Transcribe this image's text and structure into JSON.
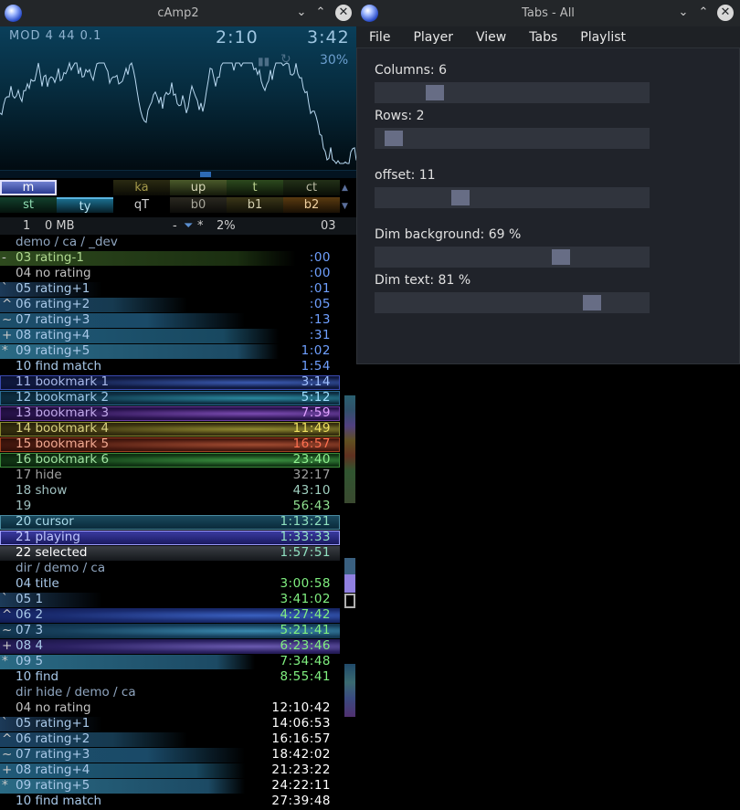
{
  "camp": {
    "title": "cAmp2",
    "mod_info": "MOD  4 44  0.1",
    "time_pos": "2:10",
    "time_len": "3:42",
    "pause_glyph": "▮▮",
    "repeat_glyph": "↻",
    "volume": "30%",
    "seek_fraction": 0.58,
    "buttons_row1": [
      {
        "label": "m",
        "fg": "#ffffff",
        "bg": "#3c4a96"
      },
      {
        "label": "",
        "fg": "#ffffff",
        "bg": "#000000"
      },
      {
        "label": "ka",
        "fg": "#a59a4a",
        "bg": "#2a2a12"
      },
      {
        "label": "up",
        "fg": "#d6d6b6",
        "bg": "#4a5a2a"
      },
      {
        "label": "t",
        "fg": "#b7cf8c",
        "bg": "#2d4a1e"
      },
      {
        "label": "ct",
        "fg": "#b7b7a0",
        "bg": "#223018"
      }
    ],
    "buttons_row2": [
      {
        "label": "st",
        "fg": "#8fdcb2",
        "bg": "#12402c"
      },
      {
        "label": "ty",
        "fg": "#b9e6f5",
        "bg": "#1a6d8d"
      },
      {
        "label": "qT",
        "fg": "#d0d0d0",
        "bg": "#000000"
      },
      {
        "label": "b0",
        "fg": "#a7a59a",
        "bg": "#2a2820"
      },
      {
        "label": "b1",
        "fg": "#d4d0b0",
        "bg": "#3a3618"
      },
      {
        "label": "b2",
        "fg": "#f0d0a0",
        "bg": "#5a3a10"
      }
    ],
    "status": {
      "index": "1",
      "size": "0 MB",
      "dash": "-",
      "filter_icon": "filter-icon",
      "star": "*",
      "percent": "2%",
      "count": "03"
    },
    "playlist": [
      {
        "pre": "",
        "name": "demo / ca / _dev",
        "time": "",
        "fg": "#8fa5bf",
        "tc": "#6fa0ff",
        "hl": "none",
        "bar": 0
      },
      {
        "pre": "-",
        "name": "03 rating-1",
        "time": ":00",
        "fg": "#b0d890",
        "tc": "#6fa0ff",
        "hl": "rating-",
        "bar": 0.87
      },
      {
        "pre": "",
        "name": "04 no rating",
        "time": ":00",
        "fg": "#c0c0c0",
        "tc": "#6fa0ff",
        "hl": "none",
        "bar": 0
      },
      {
        "pre": "`",
        "name": "05 rating+1",
        "time": ":01",
        "fg": "#a8c8e8",
        "tc": "#6fa0ff",
        "hl": "r1",
        "bar": 0.3
      },
      {
        "pre": "^",
        "name": "06 rating+2",
        "time": ":05",
        "fg": "#a8c8e8",
        "tc": "#6fa0ff",
        "hl": "r2",
        "bar": 0.55
      },
      {
        "pre": "~",
        "name": "07 rating+3",
        "time": ":13",
        "fg": "#a8c8e8",
        "tc": "#6fa0ff",
        "hl": "r3",
        "bar": 0.72
      },
      {
        "pre": "+",
        "name": "08 rating+4",
        "time": ":31",
        "fg": "#a8c8e8",
        "tc": "#6fa0ff",
        "hl": "r4",
        "bar": 0.82
      },
      {
        "pre": "*",
        "name": "09 rating+5",
        "time": "1:02",
        "fg": "#a8c8e8",
        "tc": "#6fa0ff",
        "hl": "r5",
        "bar": 0.82
      },
      {
        "pre": "",
        "name": "10 find match",
        "time": "1:54",
        "fg": "#a8c8e8",
        "tc": "#6fa0ff",
        "hl": "none",
        "bar": 0
      },
      {
        "pre": "",
        "name": "11 bookmark 1",
        "time": "3:14",
        "fg": "#a8b8e8",
        "tc": "#a0c0ff",
        "hl": "bm1",
        "bar": 1
      },
      {
        "pre": "",
        "name": "12 bookmark 2",
        "time": "5:12",
        "fg": "#9fc8e8",
        "tc": "#a0e0ff",
        "hl": "bm2",
        "bar": 1
      },
      {
        "pre": "",
        "name": "13 bookmark 3",
        "time": "7:59",
        "fg": "#c0a8e8",
        "tc": "#e0a0ff",
        "hl": "bm3",
        "bar": 1
      },
      {
        "pre": "",
        "name": "14 bookmark 4",
        "time": "11:49",
        "fg": "#d8d080",
        "tc": "#f0e060",
        "hl": "bm4",
        "bar": 1
      },
      {
        "pre": "",
        "name": "15 bookmark 5",
        "time": "16:57",
        "fg": "#f0a890",
        "tc": "#ff7050",
        "hl": "bm5",
        "bar": 1
      },
      {
        "pre": "",
        "name": "16 bookmark 6",
        "time": "23:40",
        "fg": "#a0e0a0",
        "tc": "#90f090",
        "hl": "bm6",
        "bar": 1
      },
      {
        "pre": "",
        "name": "17 hide",
        "time": "32:17",
        "fg": "#a0a0a0",
        "tc": "#a0a0a0",
        "hl": "none",
        "bar": 0
      },
      {
        "pre": "",
        "name": "18 show",
        "time": "43:10",
        "fg": "#a0c0c0",
        "tc": "#a0d0c0",
        "hl": "none",
        "bar": 0
      },
      {
        "pre": "",
        "name": "19",
        "time": "56:43",
        "fg": "#a0c0c0",
        "tc": "#90e090",
        "hl": "none",
        "bar": 0
      },
      {
        "pre": "",
        "name": "20 cursor",
        "time": "1:13:21",
        "fg": "#a8d8e8",
        "tc": "#90e0c0",
        "hl": "cursor",
        "bar": 1
      },
      {
        "pre": "",
        "name": "21 playing",
        "time": "1:33:33",
        "fg": "#c0c8ff",
        "tc": "#90e0c0",
        "hl": "playing",
        "bar": 1
      },
      {
        "pre": "",
        "name": "22 selected",
        "time": "1:57:51",
        "fg": "#ffffff",
        "tc": "#90e0c0",
        "hl": "selected",
        "bar": 1
      },
      {
        "pre": "",
        "name": "dir / demo / ca",
        "time": "",
        "fg": "#8fa5bf",
        "tc": "#6fa0ff",
        "hl": "none",
        "bar": 0
      },
      {
        "pre": "",
        "name": "04 title",
        "time": "3:00:58",
        "fg": "#a8c8e8",
        "tc": "#80f080",
        "hl": "none",
        "bar": 0
      },
      {
        "pre": "`",
        "name": "05 1",
        "time": "3:41:02",
        "fg": "#a8c8e8",
        "tc": "#80f080",
        "hl": "d1",
        "bar": 0.3
      },
      {
        "pre": "^",
        "name": "06 2",
        "time": "4:27:42",
        "fg": "#a8c8e8",
        "tc": "#80f080",
        "hl": "d2",
        "bar": 1
      },
      {
        "pre": "~",
        "name": "07 3",
        "time": "5:21:41",
        "fg": "#a8c8e8",
        "tc": "#80f080",
        "hl": "d3",
        "bar": 1
      },
      {
        "pre": "+",
        "name": "08 4",
        "time": "6:23:46",
        "fg": "#a8c8e8",
        "tc": "#80f080",
        "hl": "d4",
        "bar": 1
      },
      {
        "pre": "*",
        "name": "09 5",
        "time": "7:34:48",
        "fg": "#a8c8e8",
        "tc": "#80f080",
        "hl": "d5",
        "bar": 0.75
      },
      {
        "pre": "",
        "name": "10 find",
        "time": "8:55:41",
        "fg": "#a8c8e8",
        "tc": "#80f080",
        "hl": "none",
        "bar": 0
      },
      {
        "pre": "",
        "name": "dir hide / demo / ca",
        "time": "",
        "fg": "#8fa5bf",
        "tc": "#ffffff",
        "hl": "none",
        "bar": 0
      },
      {
        "pre": "",
        "name": "04 no rating",
        "time": "12:10:42",
        "fg": "#c0c0c0",
        "tc": "#ffffff",
        "hl": "none",
        "bar": 0
      },
      {
        "pre": "`",
        "name": "05 rating+1",
        "time": "14:06:53",
        "fg": "#a8c8e8",
        "tc": "#ffffff",
        "hl": "r1",
        "bar": 0.3
      },
      {
        "pre": "^",
        "name": "06 rating+2",
        "time": "16:16:57",
        "fg": "#a8c8e8",
        "tc": "#ffffff",
        "hl": "r2",
        "bar": 0.55
      },
      {
        "pre": "~",
        "name": "07 rating+3",
        "time": "18:42:02",
        "fg": "#a8c8e8",
        "tc": "#ffffff",
        "hl": "r3",
        "bar": 0.72
      },
      {
        "pre": "+",
        "name": "08 rating+4",
        "time": "21:23:22",
        "fg": "#a8c8e8",
        "tc": "#ffffff",
        "hl": "r4",
        "bar": 0.72
      },
      {
        "pre": "*",
        "name": "09 rating+5",
        "time": "24:22:11",
        "fg": "#a8c8e8",
        "tc": "#ffffff",
        "hl": "r5",
        "bar": 0.72
      },
      {
        "pre": "",
        "name": "10 find match",
        "time": "27:39:48",
        "fg": "#a8c8e8",
        "tc": "#ffffff",
        "hl": "none",
        "bar": 0
      }
    ]
  },
  "tabs": {
    "title": "Tabs - All",
    "menu": [
      "File",
      "Player",
      "View",
      "Tabs",
      "Playlist"
    ],
    "settings": [
      {
        "label": "Columns:  6",
        "value_fraction": 0.2
      },
      {
        "label": "Rows:  2",
        "value_fraction": 0.04
      },
      {
        "label": "offset: 11",
        "value_fraction": 0.3
      },
      {
        "label": "Dim background:  69 %",
        "value_fraction": 0.69
      },
      {
        "label": "Dim text:  81 %",
        "value_fraction": 0.81
      }
    ]
  }
}
